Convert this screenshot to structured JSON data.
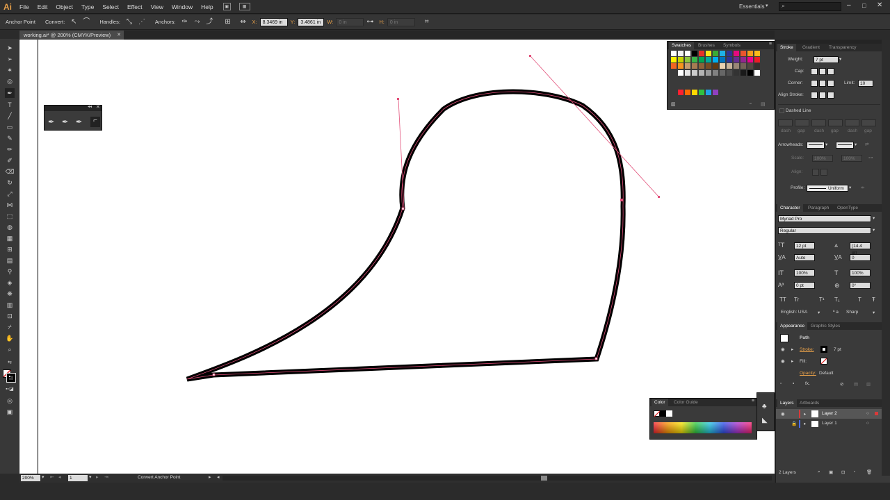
{
  "app": {
    "logo": "Ai"
  },
  "menu": [
    "File",
    "Edit",
    "Object",
    "Type",
    "Select",
    "Effect",
    "View",
    "Window",
    "Help"
  ],
  "workspace": {
    "name": "Essentials"
  },
  "control_bar": {
    "tool_name": "Anchor Point",
    "convert_label": "Convert:",
    "handles_label": "Handles:",
    "anchors_label": "Anchors:",
    "x_label": "X:",
    "x_value": "8.3469 in",
    "y_label": "Y:",
    "y_value": "3.4861 in",
    "w_label": "W:",
    "w_value": "0 in",
    "h_label": "H:",
    "h_value": "0 in"
  },
  "document": {
    "tab_title": "working.ai* @ 200% (CMYK/Preview)"
  },
  "status": {
    "zoom": "200%",
    "artboard": "1",
    "tool": "Convert Anchor Point"
  },
  "swatches_panel": {
    "tabs": [
      "Swatches",
      "Brushes",
      "Symbols"
    ]
  },
  "stroke_panel": {
    "tabs": [
      "Stroke",
      "Gradient",
      "Transparency"
    ],
    "weight_label": "Weight:",
    "weight_value": "7 pt",
    "cap_label": "Cap:",
    "corner_label": "Corner:",
    "limit_label": "Limit:",
    "limit_value": "10",
    "align_label": "Align Stroke:",
    "dashed_label": "Dashed Line",
    "dash_labels": [
      "dash",
      "gap",
      "dash",
      "gap",
      "dash",
      "gap"
    ],
    "arrowheads_label": "Arrowheads:",
    "scale_label": "Scale:",
    "scale1": "100%",
    "scale2": "100%",
    "align2_label": "Align:",
    "profile_label": "Profile:",
    "profile_value": "Uniform"
  },
  "character_panel": {
    "tabs": [
      "Character",
      "Paragraph",
      "OpenType"
    ],
    "font": "Myriad Pro",
    "style": "Regular",
    "size": "12 pt",
    "leading": "(14.4 pt)",
    "kerning": "Auto",
    "tracking": "0",
    "vscale": "100%",
    "hscale": "100%",
    "baseline": "0 pt",
    "rotation": "0°",
    "type_styles": [
      "TT",
      "Tr",
      "T¹",
      "T₁",
      "T",
      "Ŧ"
    ],
    "language": "English: USA",
    "aa_label": "ª a",
    "antialias": "Sharp"
  },
  "appearance_panel": {
    "tabs": [
      "Appearance",
      "Graphic Styles"
    ],
    "object": "Path",
    "stroke_label": "Stroke:",
    "stroke_value": "7 pt",
    "fill_label": "Fill:",
    "opacity_label": "Opacity:",
    "opacity_value": "Default"
  },
  "color_panel": {
    "tabs": [
      "Color",
      "Color Guide"
    ]
  },
  "layers_panel": {
    "tabs": [
      "Layers",
      "Artboards"
    ],
    "layers": [
      {
        "name": "Layer 2",
        "color": "#d83a3a"
      },
      {
        "name": "Layer 1",
        "color": "#4a6cf0"
      }
    ],
    "footer": "2 Layers"
  },
  "colors": {
    "path_stroke": "#000000",
    "selection": "#e2507a",
    "accent": "#e8a14a"
  }
}
